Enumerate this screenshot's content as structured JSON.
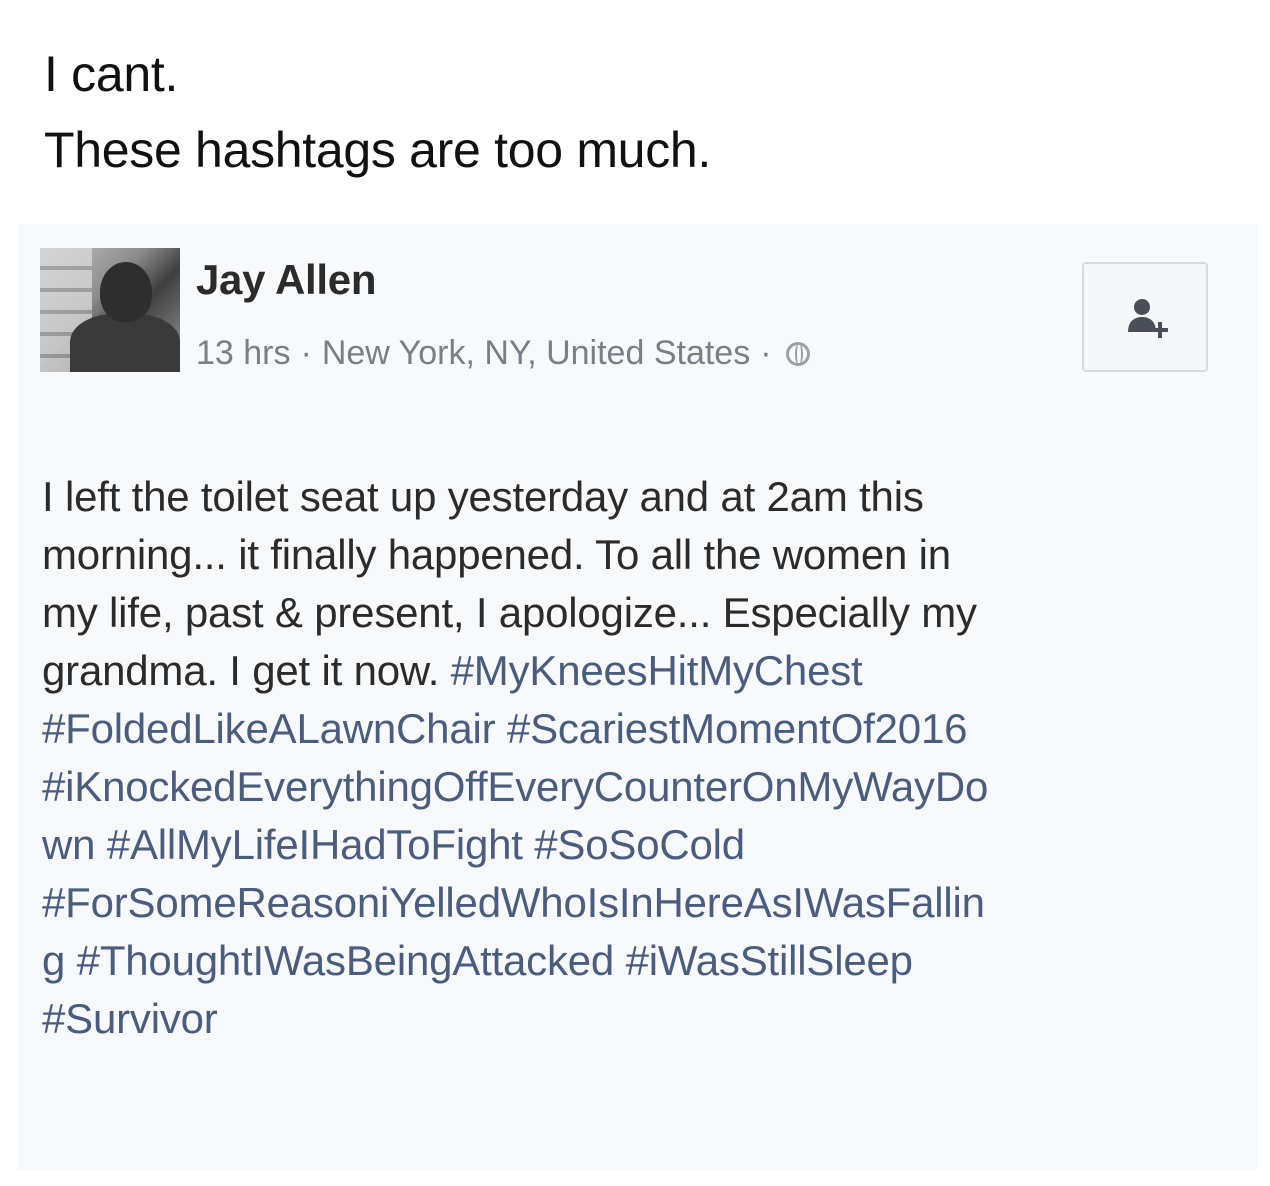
{
  "caption": {
    "line1": "I cant.",
    "line2": "These hashtags are too much."
  },
  "post": {
    "author": "Jay Allen",
    "time": "13 hrs",
    "separator": "·",
    "location": "New York, NY, United States",
    "privacy_icon": "globe-icon",
    "action_icon": "add-friend-icon",
    "lines": [
      [
        {
          "t": "I left the toilet seat up yesterday and at 2am this",
          "h": false
        }
      ],
      [
        {
          "t": "morning... it finally happened. To all the women in",
          "h": false
        }
      ],
      [
        {
          "t": "my life, past & present, I apologize... Especially my",
          "h": false
        }
      ],
      [
        {
          "t": "grandma. I get it now. ",
          "h": false
        },
        {
          "t": "#MyKneesHitMyChest",
          "h": true
        }
      ],
      [
        {
          "t": "#FoldedLikeALawnChair",
          "h": true
        },
        {
          "t": " ",
          "h": false
        },
        {
          "t": "#ScariestMomentOf2016",
          "h": true
        }
      ],
      [
        {
          "t": "#iKnockedEverythingOffEveryCounterOnMyWayDo",
          "h": true
        }
      ],
      [
        {
          "t": "wn",
          "h": true
        },
        {
          "t": " ",
          "h": false
        },
        {
          "t": "#AllMyLifeIHadToFight",
          "h": true
        },
        {
          "t": " ",
          "h": false
        },
        {
          "t": "#SoSoCold",
          "h": true
        }
      ],
      [
        {
          "t": "#ForSomeReasoniYelledWhoIsInHereAsIWasFallin",
          "h": true
        }
      ],
      [
        {
          "t": "g",
          "h": true
        },
        {
          "t": " ",
          "h": false
        },
        {
          "t": "#ThoughtIWasBeingAttacked",
          "h": true
        },
        {
          "t": " ",
          "h": false
        },
        {
          "t": "#iWasStillSleep",
          "h": true
        }
      ],
      [
        {
          "t": "#Survivor",
          "h": true
        }
      ]
    ]
  },
  "colors": {
    "text": "#2b2b2b",
    "hashtag": "#4a5d7e",
    "meta": "#7a7f87",
    "post_background": "#f8f9fb"
  }
}
